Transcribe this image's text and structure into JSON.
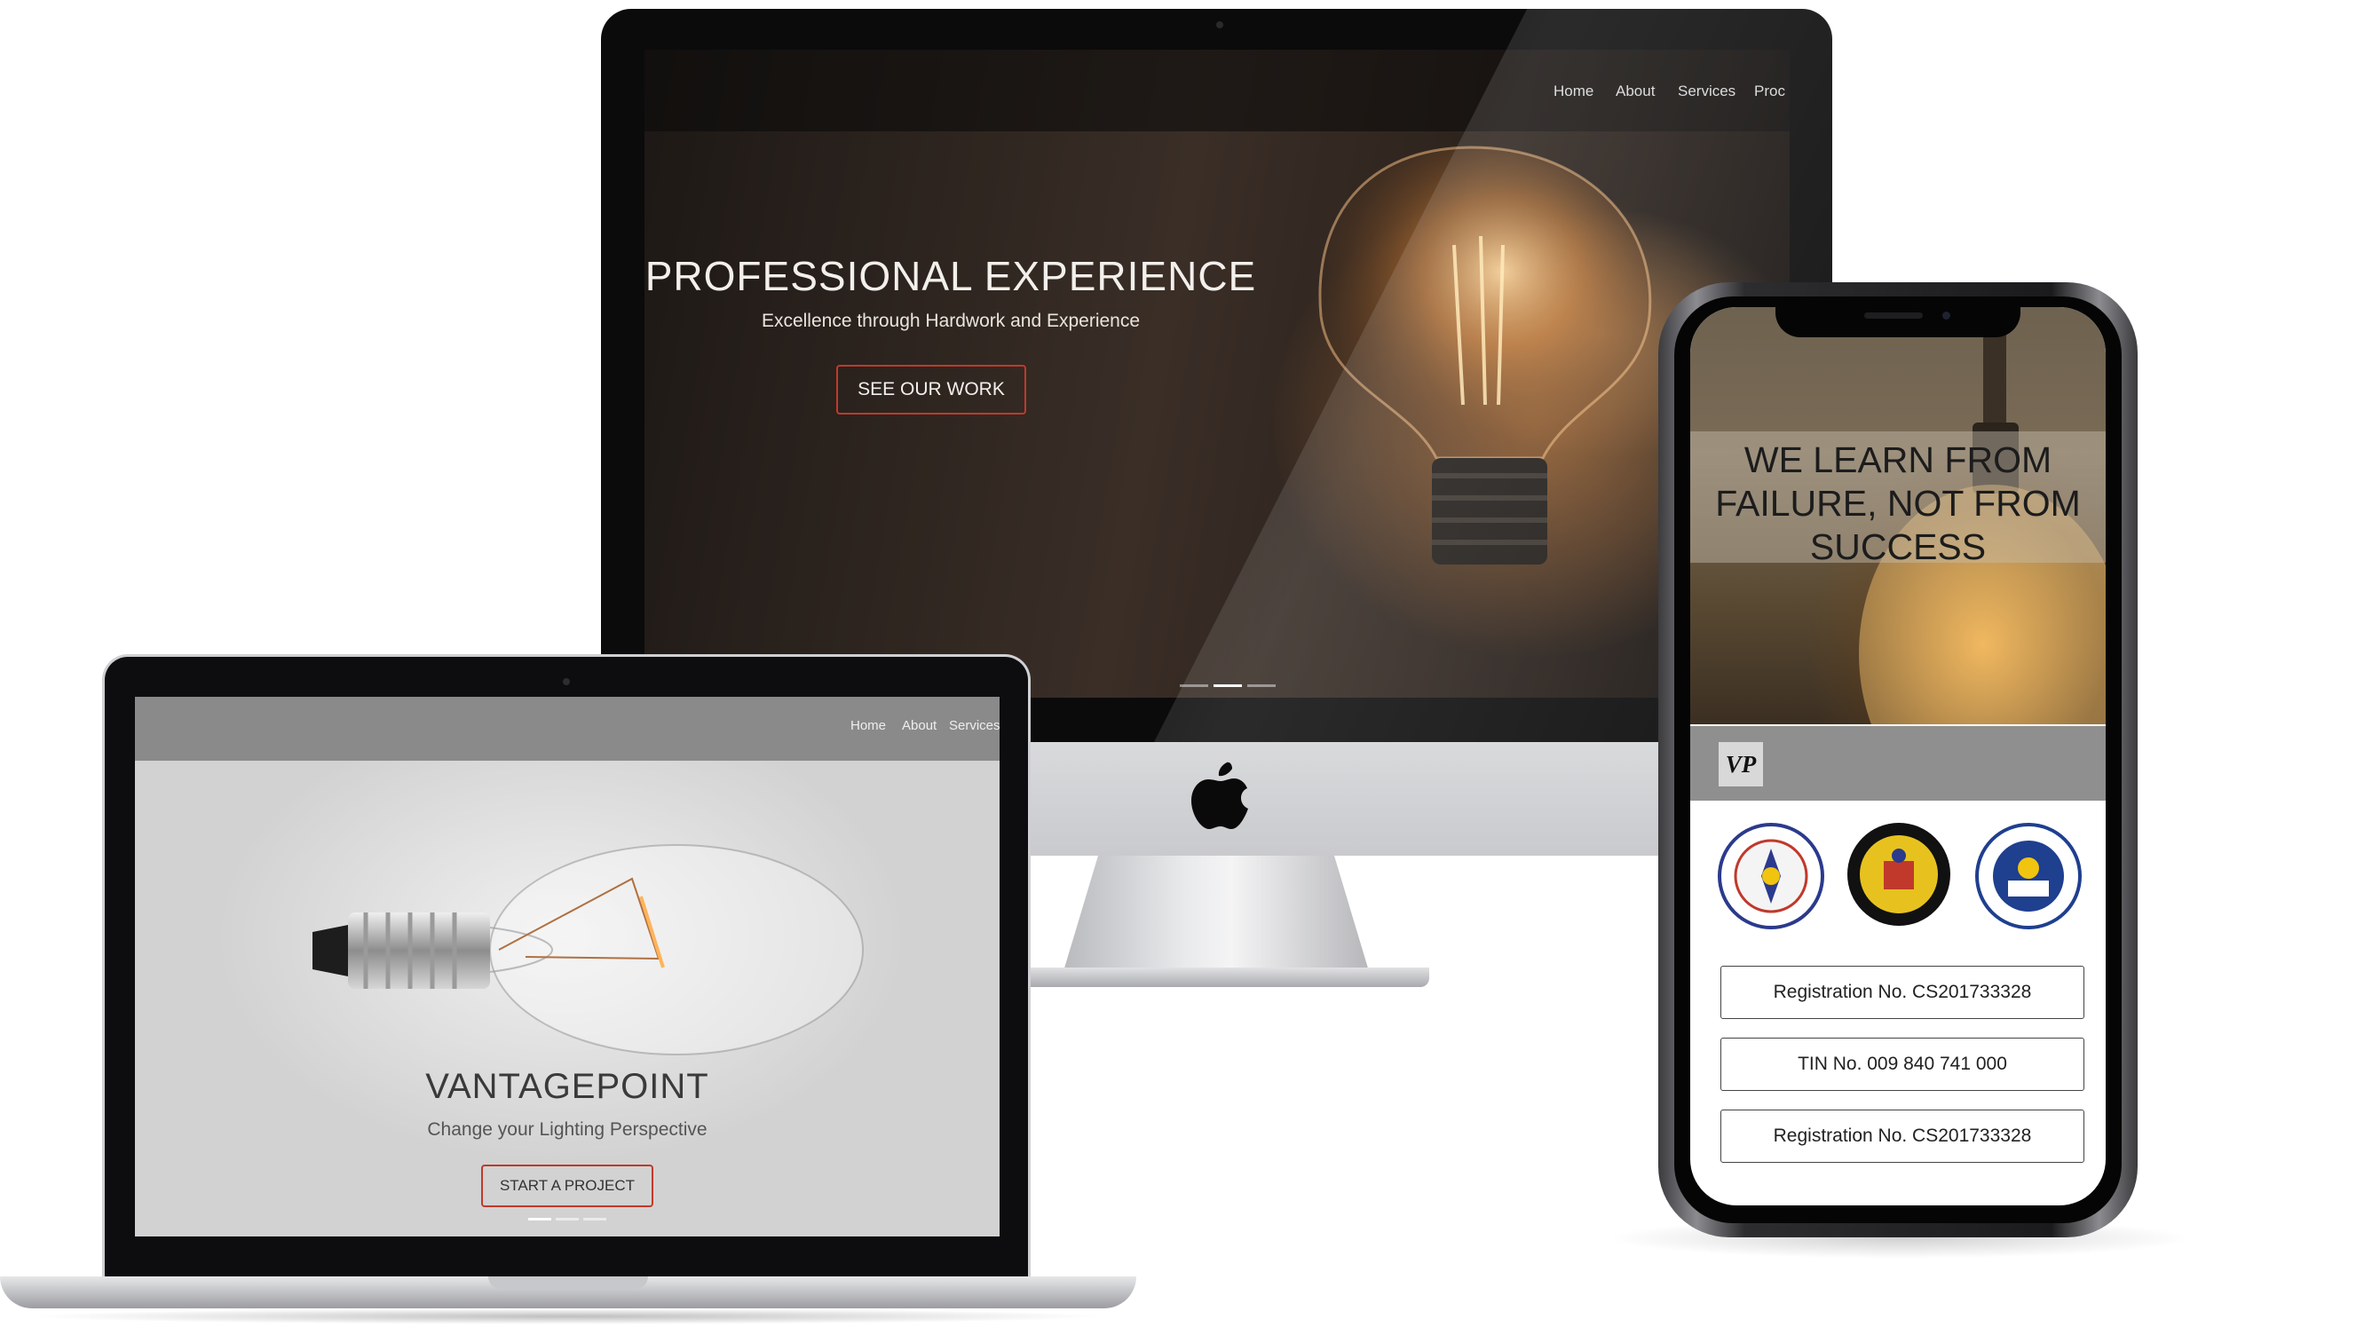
{
  "imac": {
    "nav": [
      "Home",
      "About",
      "Services",
      "Proc"
    ],
    "headline": "PROFESSIONAL EXPERIENCE",
    "subtitle": "Excellence through Hardwork and Experience",
    "cta": "SEE OUR WORK",
    "logo_glyph": ""
  },
  "laptop": {
    "nav": [
      "Home",
      "About",
      "Services"
    ],
    "title": "VANTAGEPOINT",
    "subtitle": "Change your Lighting Perspective",
    "cta": "START A PROJECT"
  },
  "phone": {
    "quote": "WE LEARN FROM FAILURE, NOT FROM SUCCESS",
    "logo": "VP",
    "registrations": [
      "Registration No. CS201733328",
      "TIN No. 009 840 741 000",
      "Registration No. CS201733328"
    ]
  },
  "colors": {
    "accent_red": "#c0392b",
    "phone_brandbar": "#8f8f8f",
    "laptop_nav": "#8a8a8a"
  }
}
